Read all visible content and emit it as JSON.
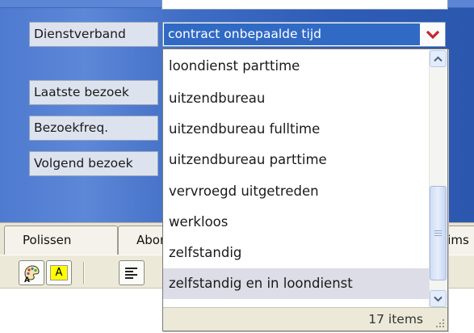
{
  "form": {
    "labels": {
      "dienstverband": "Dienstverband",
      "laatste_bezoek": "Laatste bezoek",
      "bezoekfreq": "Bezoekfreq.",
      "volgend_bezoek": "Volgend bezoek"
    },
    "dienstverband_value": "contract onbepaalde tijd",
    "dropdown_arrow_icon": "chevron-down-icon"
  },
  "dropdown": {
    "items": [
      "loondienst parttime",
      "uitzendbureau",
      "uitzendbureau fulltime",
      "uitzendbureau parttime",
      "vervroegd uitgetreden",
      "werkloos",
      "zelfstandig",
      "zelfstandig en in loondienst"
    ],
    "selected_index": 7,
    "count_label": "17 items",
    "scroll_position": 0.62
  },
  "tabs": [
    "Polissen",
    "Abon",
    "aims"
  ],
  "toolbar": {
    "icons": [
      "paint-palette-icon",
      "highlight-text-icon",
      "align-left-icon"
    ],
    "highlight_label": "A"
  },
  "colors": {
    "panel_blue": "#3f6cc4",
    "selection_blue": "#316ac5",
    "selected_item_bg": "#dcdde6",
    "arrow_red": "#c4262e"
  }
}
